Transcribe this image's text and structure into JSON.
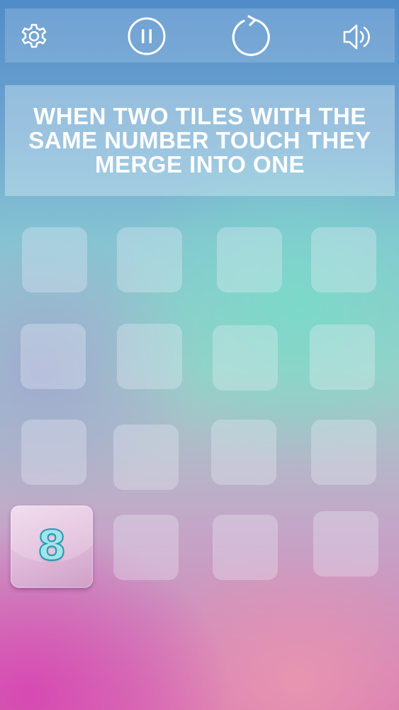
{
  "toolbar": {
    "buttons": [
      {
        "id": "settings",
        "icon": "gear-icon"
      },
      {
        "id": "pause",
        "icon": "pause-icon"
      },
      {
        "id": "restart",
        "icon": "restart-icon"
      },
      {
        "id": "sound",
        "icon": "speaker-icon"
      }
    ]
  },
  "hint": {
    "text": "WHEN TWO TILES WITH THE SAME NUMBER TOUCH THEY MERGE INTO ONE"
  },
  "board": {
    "rows": 4,
    "columns": 4,
    "tiles": [
      {
        "row": 4,
        "column": 1,
        "value": "8"
      }
    ]
  },
  "colors": {
    "icon": "#ffffff",
    "hint_text": "#ffffff",
    "tile_number_fill": "#9fe6ea",
    "tile_number_outline": "#2a97b0",
    "tile_face": "#dfb9d9"
  }
}
